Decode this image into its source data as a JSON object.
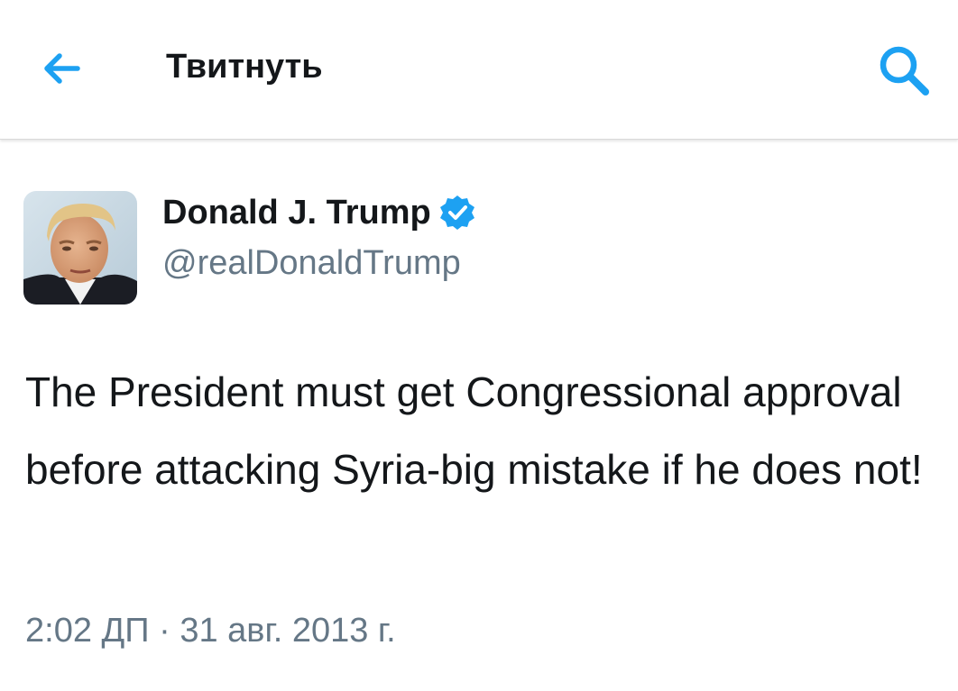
{
  "header": {
    "back_icon": "arrow-left-icon",
    "title": "Твитнуть",
    "search_icon": "search-icon",
    "accent_color": "#1da1f2"
  },
  "tweet": {
    "author": {
      "name": "Donald J. Trump",
      "handle": "@realDonaldTrump",
      "verified_icon": "verified-badge-icon"
    },
    "text": "The President must get Congressional approval before attacking Syria-big mistake if he does not!",
    "timestamp": "2:02 ДП · 31 авг. 2013 г."
  }
}
